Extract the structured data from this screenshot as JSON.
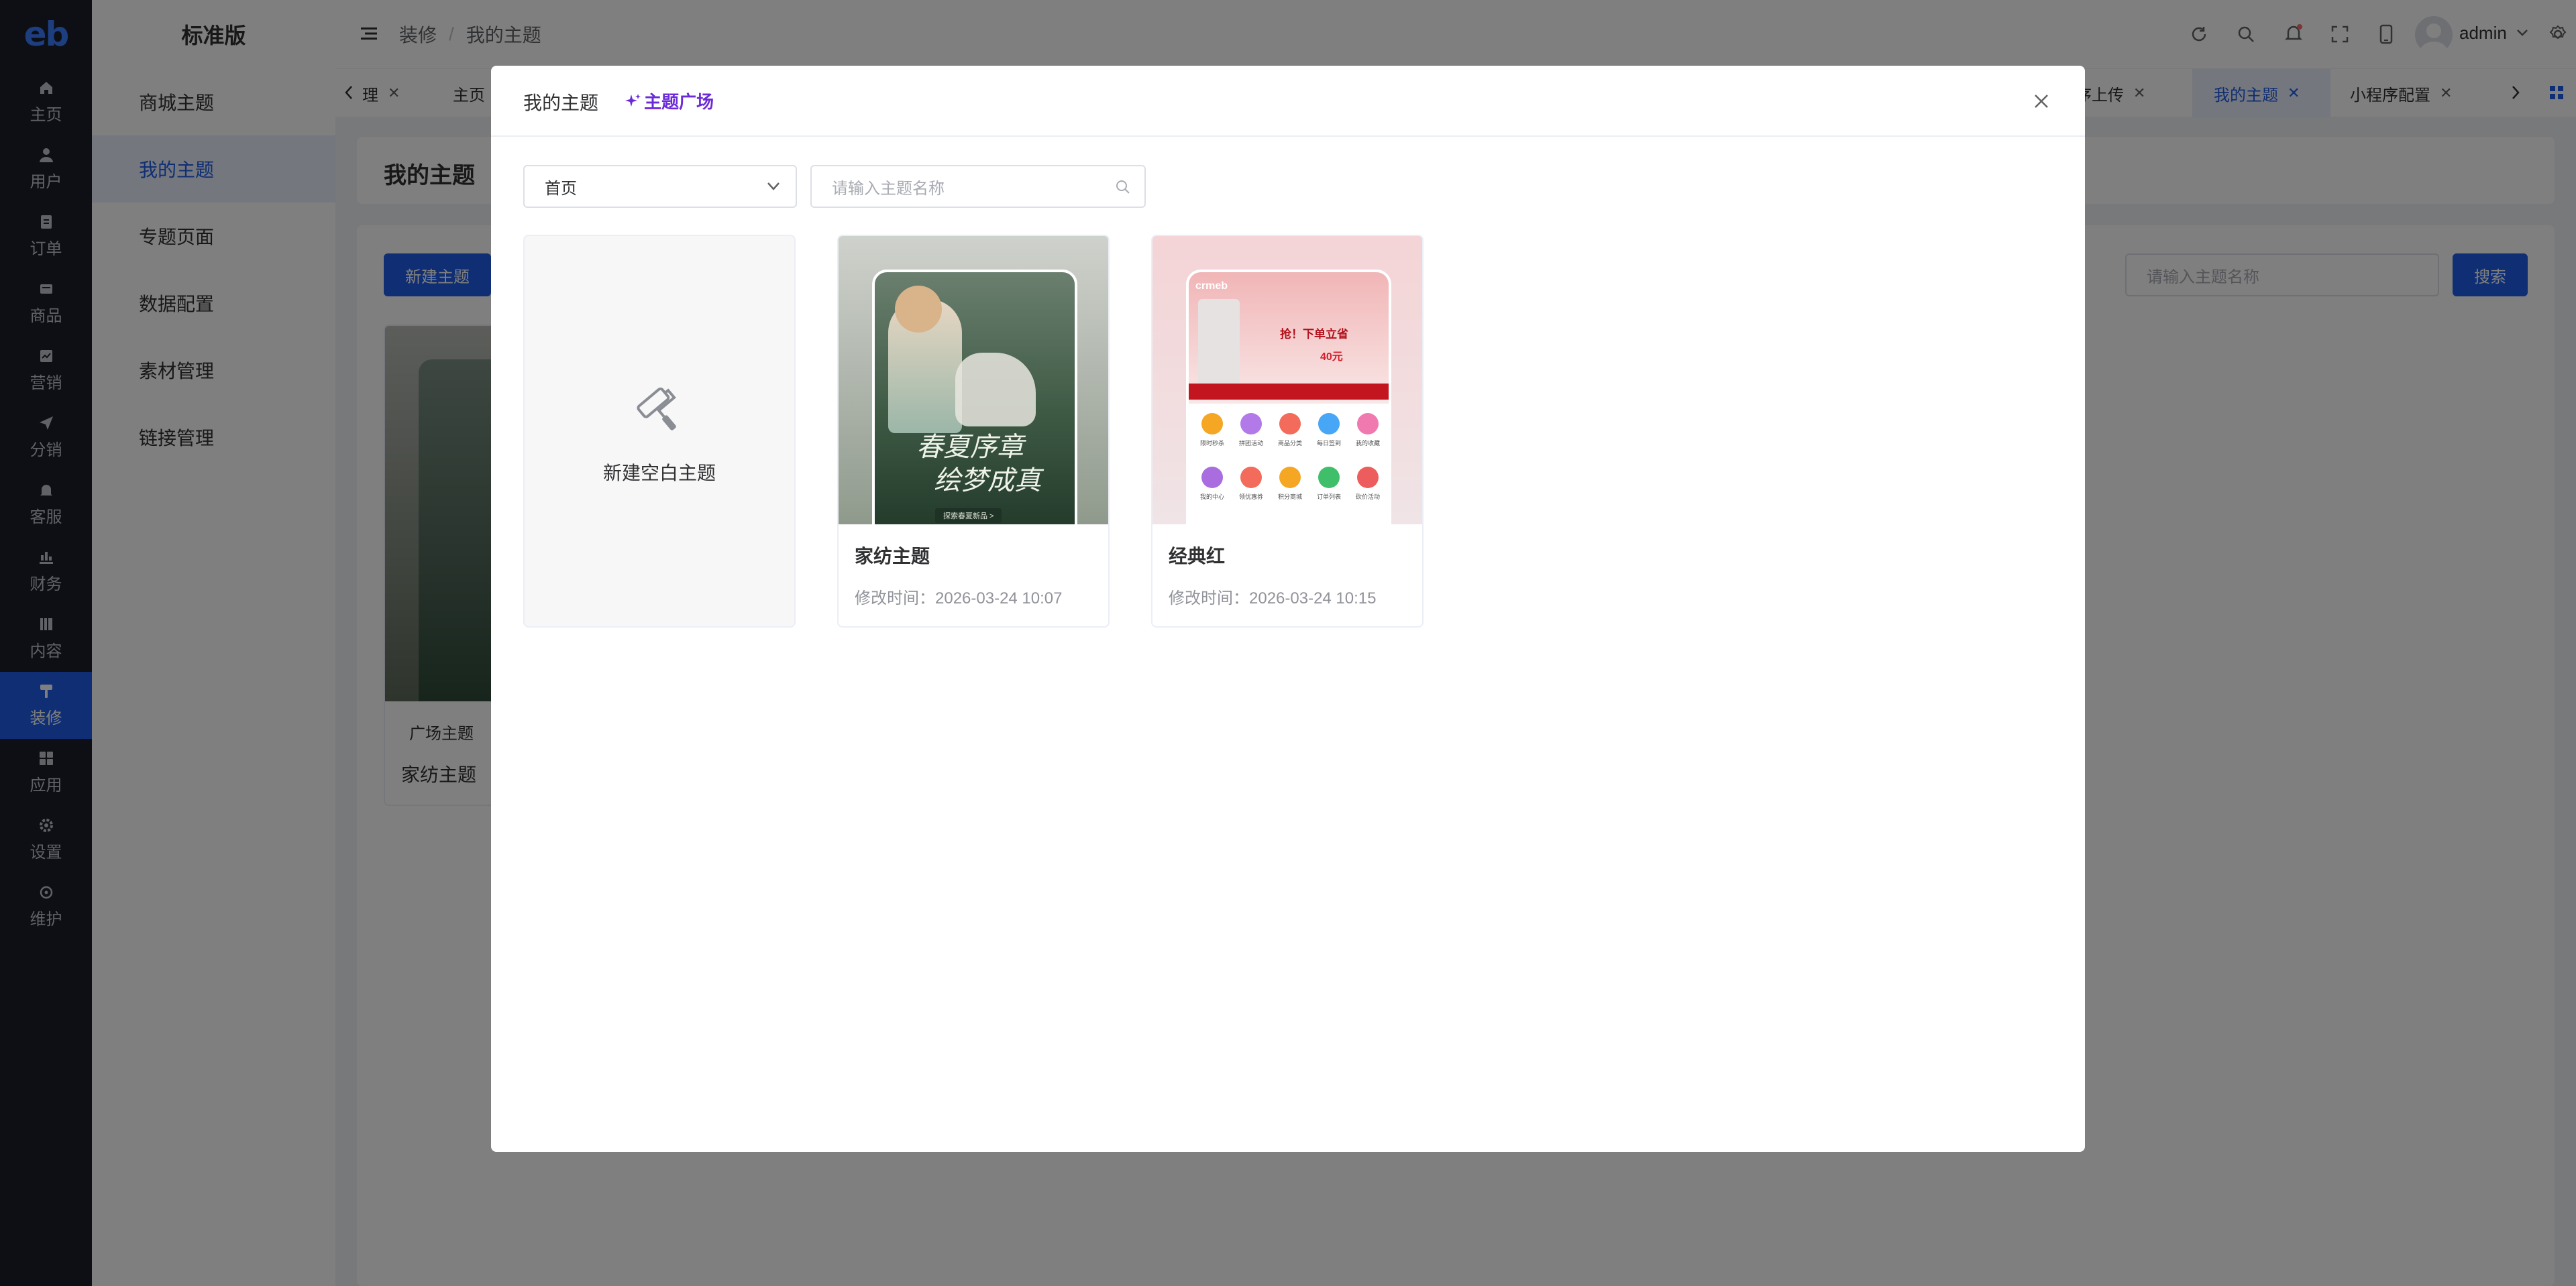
{
  "logo": {
    "text": "eb"
  },
  "rail": [
    {
      "label": "主页",
      "icon": "home-icon"
    },
    {
      "label": "用户",
      "icon": "user-icon"
    },
    {
      "label": "订单",
      "icon": "order-icon"
    },
    {
      "label": "商品",
      "icon": "product-icon"
    },
    {
      "label": "营销",
      "icon": "marketing-icon"
    },
    {
      "label": "分销",
      "icon": "distribution-icon"
    },
    {
      "label": "客服",
      "icon": "service-bell-icon"
    },
    {
      "label": "财务",
      "icon": "finance-icon"
    },
    {
      "label": "内容",
      "icon": "content-icon"
    },
    {
      "label": "装修",
      "icon": "decoration-roller-icon",
      "active": true
    },
    {
      "label": "应用",
      "icon": "apps-grid-icon"
    },
    {
      "label": "设置",
      "icon": "settings-gear-icon"
    },
    {
      "label": "维护",
      "icon": "maintenance-icon"
    }
  ],
  "submenu": {
    "title": "标准版",
    "items": [
      "商城主题",
      "我的主题",
      "专题页面",
      "数据配置",
      "素材管理",
      "链接管理"
    ],
    "active_index": 1
  },
  "header": {
    "breadcrumb_root": "装修",
    "breadcrumb_sep": "/",
    "breadcrumb_current": "我的主题",
    "user_name": "admin"
  },
  "tabs": [
    {
      "label": "理"
    },
    {
      "label": "主页"
    },
    {
      "label": "程序上传"
    },
    {
      "label": "我的主题",
      "active": true
    },
    {
      "label": "小程序配置"
    },
    {
      "label": "{"
    }
  ],
  "page": {
    "title": "我的主题",
    "new_button": "新建主题",
    "search_placeholder": "请输入主题名称",
    "search_button": "搜索",
    "card_tag": "广场主题",
    "card_name": "家纺主题"
  },
  "modal": {
    "title": "我的主题",
    "plaza_link": "主题广场",
    "select_value": "首页",
    "search_placeholder": "请输入主题名称",
    "new_blank_label": "新建空白主题",
    "themes": [
      {
        "name": "家纺主题",
        "time_label": "修改时间：",
        "time": "2026-03-24 10:07",
        "poster_line1": "春夏序章",
        "poster_line2": "绘梦成真",
        "poster_button": "探索春夏新品 >"
      },
      {
        "name": "经典红",
        "time_label": "修改时间：",
        "time": "2026-03-24 10:15",
        "banner_text": "抢！下单立省",
        "banner_amount": "40元",
        "logo_text": "crmeb",
        "shortcuts": [
          "限时秒杀",
          "拼团活动",
          "商品分类",
          "每日签到",
          "我的收藏",
          "我的中心",
          "领优惠券",
          "积分商城",
          "订单列表",
          "砍价活动"
        ]
      }
    ]
  },
  "colors": {
    "primary": "#1e5de6",
    "plaza": "#6c2bd9",
    "rail_bg": "#1a1e2a"
  }
}
